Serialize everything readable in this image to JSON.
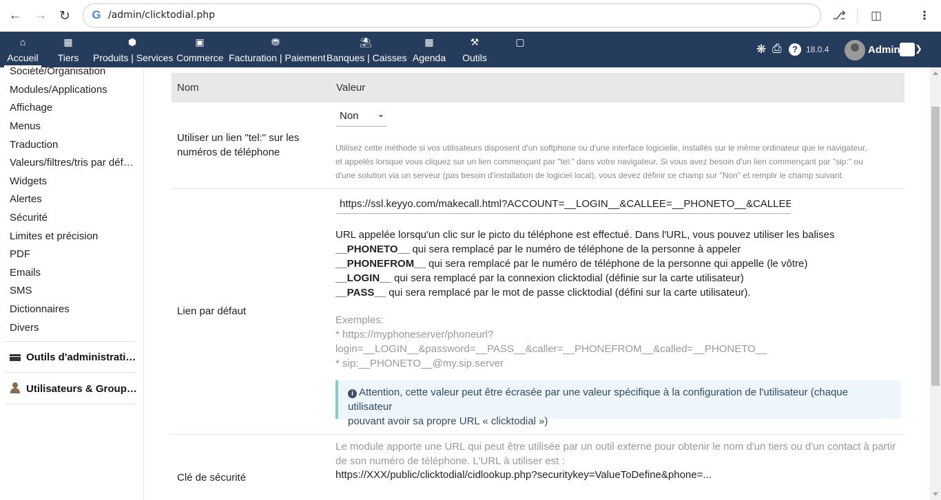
{
  "browser": {
    "url": "/admin/clicktodial.php"
  },
  "topmenu": {
    "items": [
      {
        "label": "Accueil",
        "icon": "home-icon"
      },
      {
        "label": "Tiers",
        "icon": "building-icon"
      },
      {
        "label": "Produits | Services",
        "icon": "cube-icon"
      },
      {
        "label": "Commerce",
        "icon": "briefcase-icon"
      },
      {
        "label": "Facturation | Paiement",
        "icon": "coins-icon"
      },
      {
        "label": "Banques | Caisses",
        "icon": "bank-icon"
      },
      {
        "label": "Agenda",
        "icon": "calendar-icon"
      },
      {
        "label": "Outils",
        "icon": "wrench-icon"
      },
      {
        "label": "",
        "icon": "note-icon"
      }
    ],
    "version": "18.0.4",
    "user": "Admin"
  },
  "sidebar": {
    "items": [
      "Société/Organisation",
      "Modules/Applications",
      "Affichage",
      "Menus",
      "Traduction",
      "Valeurs/filtres/tris par déf…",
      "Widgets",
      "Alertes",
      "Sécurité",
      "Limites et précision",
      "PDF",
      "Emails",
      "SMS",
      "Dictionnaires",
      "Divers"
    ],
    "sections": [
      {
        "label": "Outils d'administrati…",
        "icon": "tools-icon"
      },
      {
        "label": "Utilisateurs & Group…",
        "icon": "user-icon"
      }
    ]
  },
  "table": {
    "col_name": "Nom",
    "col_value": "Valeur",
    "row1": {
      "label_line1": "Utiliser un lien \"tel:\" sur les",
      "label_line2": "numéros de téléphone",
      "select_value": "Non",
      "help_line1": "Utilisez cette méthode si vos utilisateurs disposent d'un softphone ou d'une interface logicielle, installés sur le même ordinateur que le navigateur,",
      "help_line2": "et appelés lorsque vous cliquez sur un lien commençant par \"tel:\" dans votre navigateur. Si vous avez besoin d'un lien commençant par \"sip:\" ou",
      "help_line3": "d'une solution via un serveur (pas besoin d'installation de logiciel local), vous devez définir ce champ sur \"Non\" et remplir le champ suivant."
    },
    "row2": {
      "label": "Lien par défaut",
      "input_value": "https://ssl.keyyo.com/makecall.html?ACCOUNT=__LOGIN__&CALLEE=__PHONETO__&CALLEE_NAME=__",
      "desc_intro": "URL appelée lorsqu'un clic sur le picto du téléphone est effectué. Dans l'URL, vous pouvez utiliser les balises",
      "tag1": "__PHONETO__",
      "tag1_desc": " qui sera remplacé par le numéro de téléphone de la personne à appeler",
      "tag2": "__PHONEFROM__",
      "tag2_desc": " qui sera remplacé par le numéro de téléphone de la personne qui appelle (le vôtre)",
      "tag3": "__LOGIN__",
      "tag3_desc": " qui sera remplacé par la connexion clicktodial (définie sur la carte utilisateur)",
      "tag4": "__PASS__",
      "tag4_desc": " qui sera remplacé par le mot de passe clicktodial (défini sur la carte utilisateur).",
      "examples_title": "Exemples:",
      "example1a": "* https://myphoneserver/phoneurl?",
      "example1b": "login=__LOGIN__&password=__PASS__&caller=__PHONEFROM__&called=__PHONETO__",
      "example2": "* sip:__PHONETO__@my.sip.server",
      "warning_line1": "Attention, cette valeur peut être écrasée par une valeur spécifique à la configuration de l'utilisateur (chaque utilisateur",
      "warning_line2": "pouvant avoir sa propre URL « clicktodial »)"
    },
    "row3": {
      "label": "Clé de sécurité",
      "desc_line1": "Le module apporte une URL qui peut être utilisée par un outil externe pour obtenir le nom d'un tiers ou d'un contact à partir",
      "desc_line2": "de son numéro de téléphone. L'URL à utiliser est :",
      "url": "https://XXX/public/clicktodial/cidlookup.php?securitykey=ValueToDefine&phone=..."
    }
  }
}
